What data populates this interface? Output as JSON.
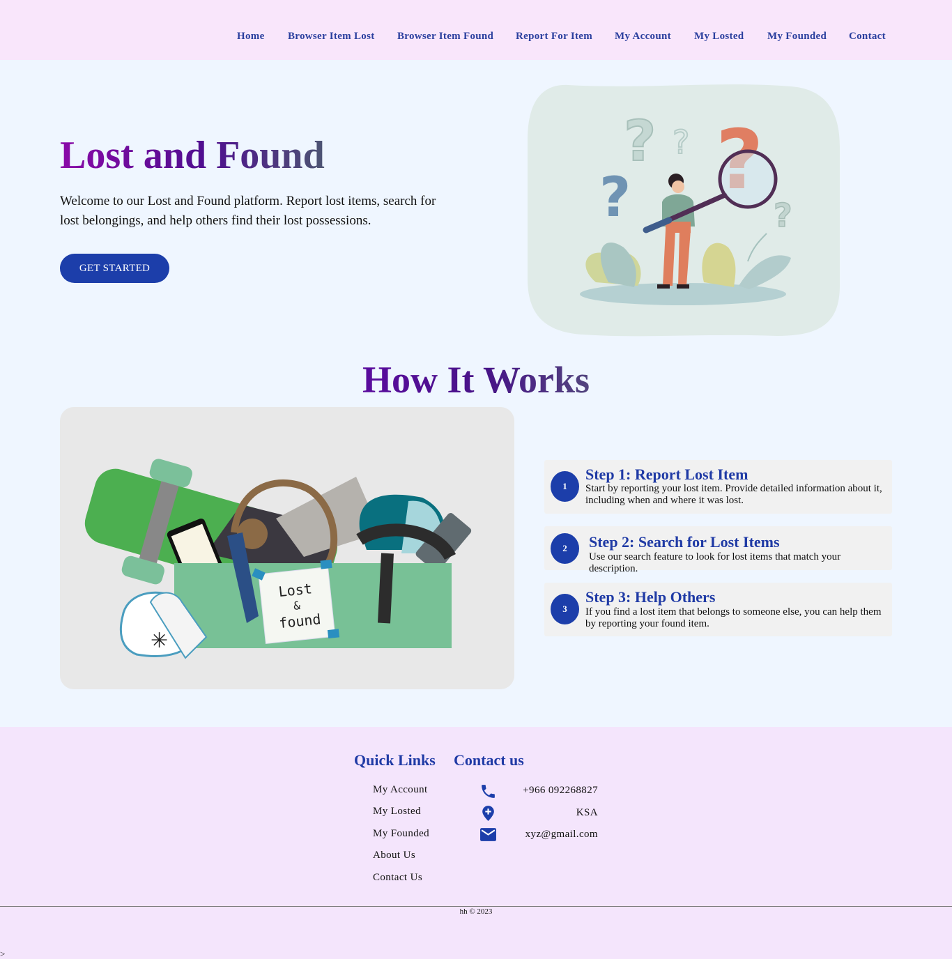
{
  "nav": {
    "items": [
      {
        "label": "Home"
      },
      {
        "label": "Browser Item Lost"
      },
      {
        "label": "Browser Item Found"
      },
      {
        "label": "Report For Item"
      },
      {
        "label": "My Account"
      },
      {
        "label": "My Losted"
      },
      {
        "label": "My Founded"
      },
      {
        "label": "Contact"
      }
    ]
  },
  "hero": {
    "title": "Lost and Found",
    "description": "Welcome to our Lost and Found platform. Report lost items, search for lost belongings, and help others find their lost possessions.",
    "cta_label": "GET STARTED"
  },
  "how": {
    "title": "How It Works",
    "box_note": {
      "line1": "Lost",
      "line2": "&",
      "line3": "found"
    },
    "steps": [
      {
        "number": "1",
        "title": "Step 1: Report Lost Item",
        "text": "Start by reporting your lost item. Provide detailed information about it, including when and where it was lost."
      },
      {
        "number": "2",
        "title": "Step 2: Search for Lost Items",
        "text": "Use our search feature to look for lost items that match your description."
      },
      {
        "number": "3",
        "title": "Step 3: Help Others",
        "text": "If you find a lost item that belongs to someone else, you can help them by reporting your found item."
      }
    ]
  },
  "footer": {
    "quick_links_title": "Quick Links",
    "contact_title": "Contact us",
    "quick_links": [
      {
        "label": "My Account"
      },
      {
        "label": "My Losted"
      },
      {
        "label": "My Founded"
      },
      {
        "label": "About Us"
      },
      {
        "label": "Contact Us"
      }
    ],
    "contact": [
      {
        "icon": "phone-icon",
        "value": "+966 092268827"
      },
      {
        "icon": "location-pin-icon",
        "value": "KSA"
      },
      {
        "icon": "mail-icon",
        "value": "xyz@gmail.com"
      }
    ],
    "copyright": "hh © 2023",
    "stray_text": ">"
  },
  "colors": {
    "nav_bg": "#f9e6fb",
    "page_bg": "#eff6ff",
    "footer_bg": "#f4e5fc",
    "accent": "#1c3eaa",
    "link": "#2a3f9e"
  }
}
